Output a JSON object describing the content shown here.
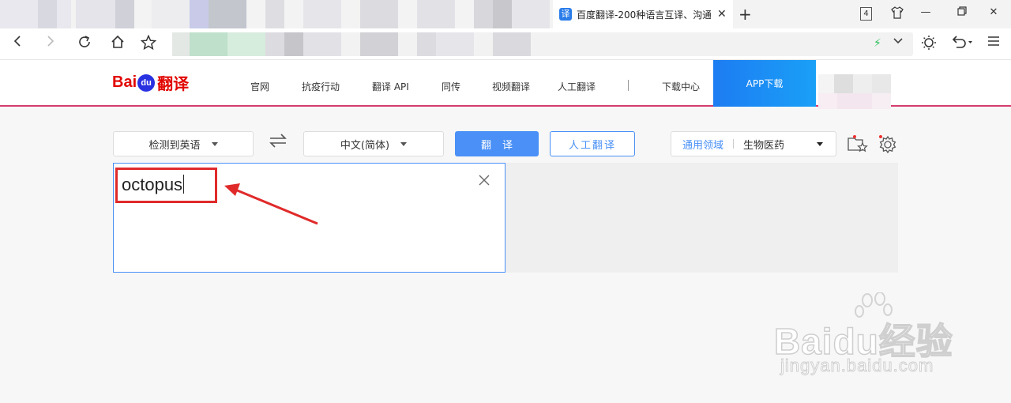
{
  "browser": {
    "active_tab": {
      "favicon_label": "译",
      "title": "百度翻译-200种语言互译、沟通"
    },
    "tab_count": "4",
    "icons": {
      "back": "back-arrow-icon",
      "forward": "forward-arrow-icon",
      "reload": "reload-icon",
      "home": "home-icon",
      "bookmark": "star-icon",
      "new_tab": "plus-icon",
      "menu": "hamburger-icon",
      "undo": "undo-icon",
      "theme": "sun-icon"
    }
  },
  "site": {
    "logo": {
      "prefix": "Bai",
      "paw": "du",
      "suffix": "翻译"
    },
    "nav": [
      "官网",
      "抗疫行动",
      "翻译 API",
      "同传",
      "视频翻译",
      "人工翻译",
      "下载中心"
    ],
    "app_download": "APP下载"
  },
  "translator": {
    "source_lang": "检测到英语",
    "target_lang": "中文(简体)",
    "translate_button": "翻译",
    "human_button": "人工翻译",
    "domain_label": "通用领域",
    "domain_value": "生物医药",
    "input_text": "octopus",
    "clear_icon": "close-icon"
  },
  "watermark": {
    "main": "Baidu经验",
    "sub": "jingyan.baidu.com"
  },
  "colors": {
    "accent": "#4a90f6",
    "brand_red": "#e10601",
    "annotation_red": "#e02a2a",
    "header_line": "#d63c6e"
  }
}
